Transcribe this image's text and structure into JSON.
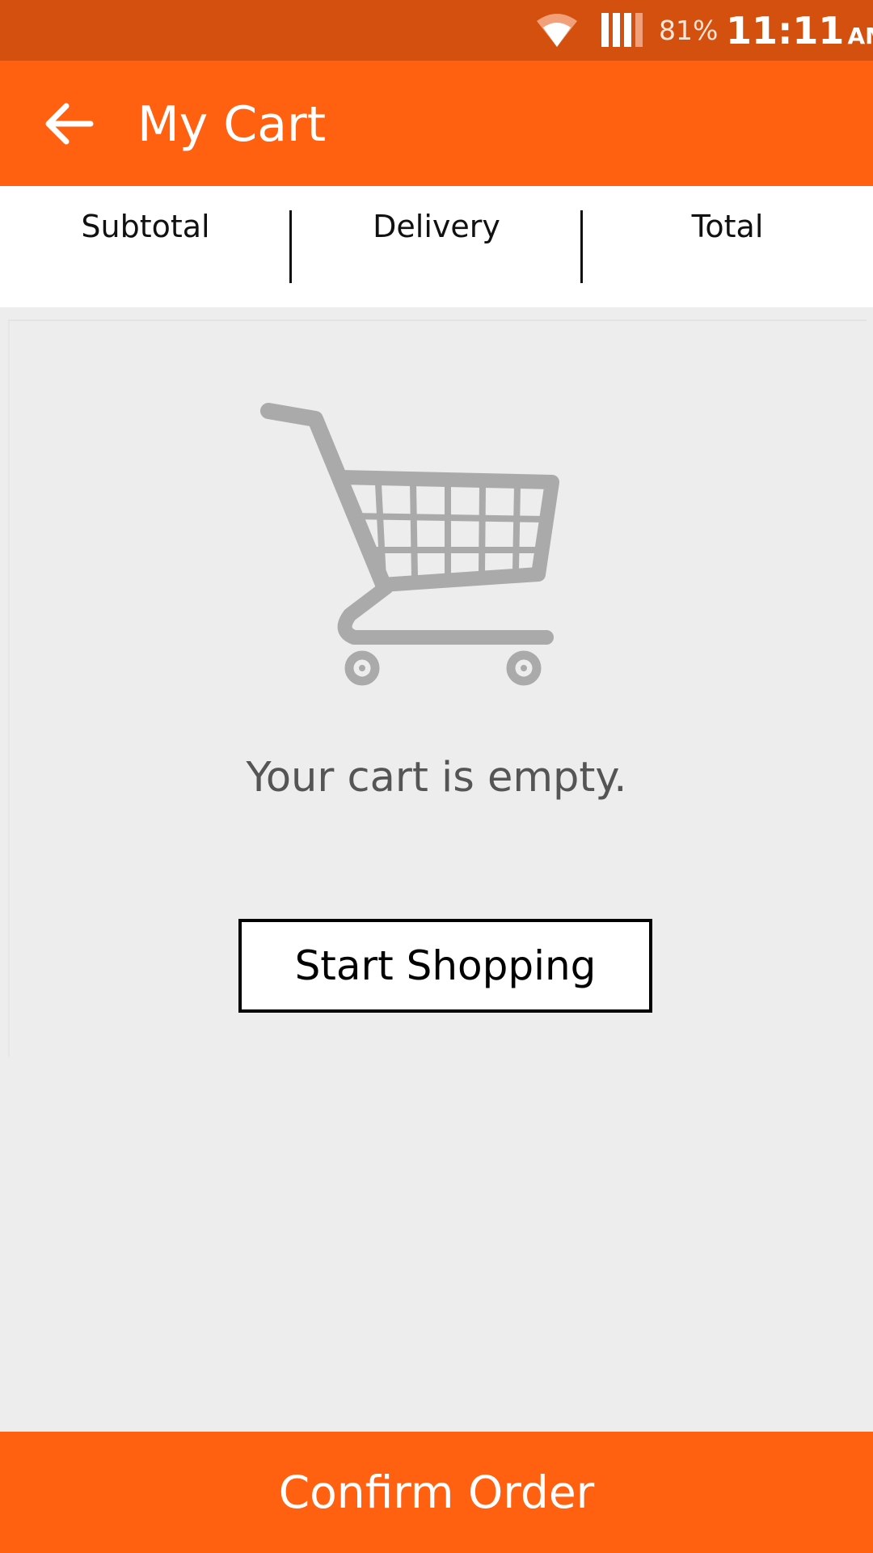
{
  "status_bar": {
    "battery": "81%",
    "time": "11:11",
    "ampm": "AM",
    "icons": [
      "wifi-icon",
      "signal-icon"
    ]
  },
  "app_bar": {
    "title": "My Cart",
    "back_icon": "arrow-left-icon"
  },
  "summary": {
    "columns": [
      "Subtotal",
      "Delivery",
      "Total"
    ]
  },
  "empty_state": {
    "icon": "shopping-cart-icon",
    "message": "Your cart is empty.",
    "button_label": "Start Shopping"
  },
  "footer": {
    "confirm_label": "Confirm Order"
  },
  "colors": {
    "status_bar": "#d4500f",
    "accent": "#ff6111",
    "background": "#ededed",
    "icon_gray": "#aaaaaa"
  }
}
